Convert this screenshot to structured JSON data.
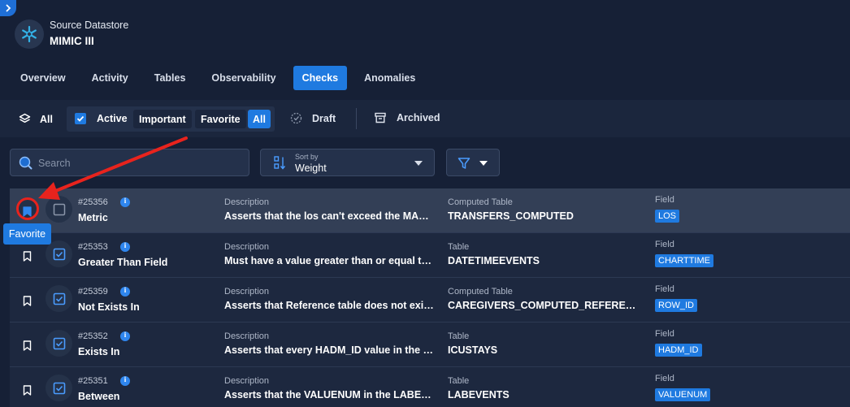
{
  "datastore": {
    "label": "Source Datastore",
    "name": "MIMIC III",
    "icon": "snowflake-icon"
  },
  "tabs": [
    {
      "label": "Overview",
      "active": false
    },
    {
      "label": "Activity",
      "active": false
    },
    {
      "label": "Tables",
      "active": false
    },
    {
      "label": "Observability",
      "active": false
    },
    {
      "label": "Checks",
      "active": true
    },
    {
      "label": "Anomalies",
      "active": false
    }
  ],
  "filters": {
    "all_label": "All",
    "active_label": "Active",
    "important_label": "Important",
    "favorite_label": "Favorite",
    "all_subfilter_label": "All",
    "draft_label": "Draft",
    "archived_label": "Archived"
  },
  "search": {
    "placeholder": "Search",
    "value": ""
  },
  "sort": {
    "label": "Sort by",
    "value": "Weight"
  },
  "checks": [
    {
      "id": "#25356",
      "name": "Metric",
      "description_label": "Description",
      "description": "Asserts that the los can't exceed the MAX value",
      "table_label": "Computed Table",
      "table": "TRANSFERS_COMPUTED",
      "field_label": "Field",
      "field": "LOS",
      "favorited": true,
      "status_checked": false
    },
    {
      "id": "#25353",
      "name": "Greater Than Field",
      "description_label": "Description",
      "description": "Must have a value greater than or equal to the ADMITTIME",
      "table_label": "Table",
      "table": "DATETIMEEVENTS",
      "field_label": "Field",
      "field": "CHARTTIME",
      "favorited": false,
      "status_checked": true
    },
    {
      "id": "#25359",
      "name": "Not Exists In",
      "description_label": "Description",
      "description": "Asserts that Reference table does not exists in the target",
      "table_label": "Computed Table",
      "table": "CAREGIVERS_COMPUTED_REFERENCE",
      "field_label": "Field",
      "field": "ROW_ID",
      "favorited": false,
      "status_checked": true
    },
    {
      "id": "#25352",
      "name": "Exists In",
      "description_label": "Description",
      "description": "Asserts that every HADM_ID value in the ICUSTAYS table exists",
      "table_label": "Table",
      "table": "ICUSTAYS",
      "field_label": "Field",
      "field": "HADM_ID",
      "favorited": false,
      "status_checked": true
    },
    {
      "id": "#25351",
      "name": "Between",
      "description_label": "Description",
      "description": "Asserts that the VALUENUM in the LABEVENTS table is between",
      "table_label": "Table",
      "table": "LABEVENTS",
      "field_label": "Field",
      "field": "VALUENUM",
      "favorited": false,
      "status_checked": true
    }
  ],
  "tooltip": {
    "label": "Favorite"
  },
  "colors": {
    "background": "#162036",
    "accent": "#1f7ae0",
    "annotation": "#e8231d"
  }
}
